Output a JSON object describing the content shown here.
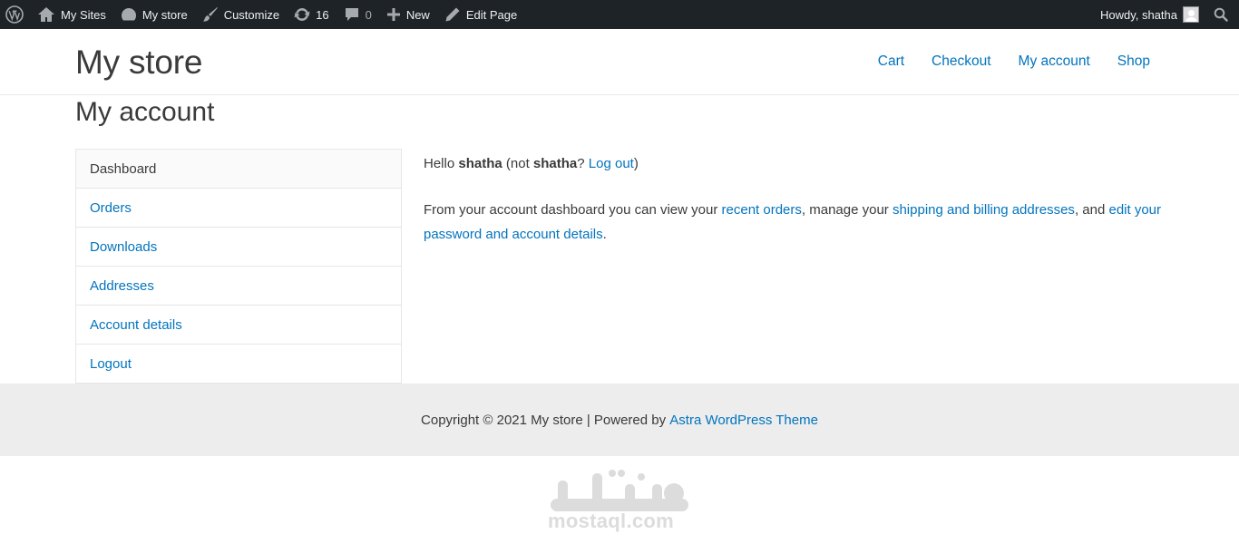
{
  "adminbar": {
    "wp_logo": "wordpress-icon",
    "my_sites": "My Sites",
    "site_name": "My store",
    "customize": "Customize",
    "updates_count": "16",
    "comments_count": "0",
    "new_label": "New",
    "edit_page": "Edit Page",
    "howdy": "Howdy, shatha",
    "colors": {
      "background": "#1d2327",
      "text": "#f0f0f1",
      "icon": "#a7aaad"
    }
  },
  "header": {
    "site_title": "My store",
    "nav": [
      "Cart",
      "Checkout",
      "My account",
      "Shop"
    ]
  },
  "page": {
    "title": "My account"
  },
  "account_nav": {
    "items": [
      {
        "label": "Dashboard",
        "active": true
      },
      {
        "label": "Orders",
        "active": false
      },
      {
        "label": "Downloads",
        "active": false
      },
      {
        "label": "Addresses",
        "active": false
      },
      {
        "label": "Account details",
        "active": false
      },
      {
        "label": "Logout",
        "active": false
      }
    ]
  },
  "content": {
    "hello": "Hello",
    "username": "shatha",
    "not_prefix": "(not",
    "not_user": "shatha",
    "not_suffix": "?",
    "logout_link": "Log out",
    "close_paren": ")",
    "dash_text_1": "From your account dashboard you can view your",
    "recent_orders": "recent orders",
    "dash_text_2": ", manage your",
    "addresses_link": "shipping and billing addresses",
    "dash_text_3": ", and",
    "account_link": "edit your password and account details",
    "dash_text_4": "."
  },
  "footer": {
    "copyright": "Copyright © 2021 My store | Powered by",
    "theme_link": "Astra WordPress Theme"
  },
  "watermark": {
    "arabic": "مستقل",
    "text": "mostaql.com"
  },
  "colors": {
    "link": "#0274be",
    "text": "#3a3a3a",
    "footer_bg": "#ededed"
  }
}
